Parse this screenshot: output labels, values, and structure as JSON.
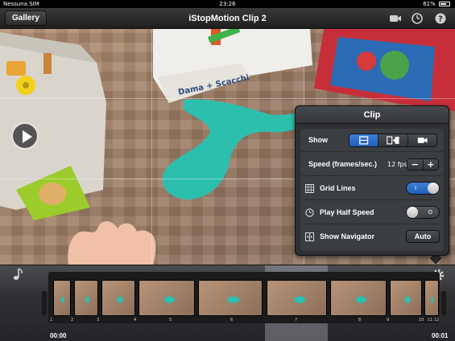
{
  "status_bar": {
    "carrier": "Nessuna SIM",
    "time": "23:26",
    "battery": "61%"
  },
  "nav": {
    "gallery_label": "Gallery",
    "title": "iStopMotion Clip 2",
    "icons": [
      "camera-icon",
      "timer-icon",
      "help-icon"
    ]
  },
  "clip_panel": {
    "title": "Clip",
    "show": {
      "label": "Show",
      "segments": [
        "film-icon",
        "frame-compare-icon",
        "camera-icon"
      ],
      "active_index": 0
    },
    "speed": {
      "label": "Speed (frames/sec.)",
      "value": "12 fps",
      "minus": "−",
      "plus": "+"
    },
    "grid_lines": {
      "label": "Grid Lines",
      "state": "on",
      "mark": "I"
    },
    "play_half_speed": {
      "label": "Play Half Speed",
      "state": "off",
      "mark": "O"
    },
    "show_navigator": {
      "label": "Show Navigator",
      "button": "Auto"
    }
  },
  "timeline": {
    "frame_numbers": [
      "1",
      "2",
      "3",
      "4",
      "5",
      "6",
      "7",
      "8",
      "9",
      "10",
      "11",
      "12"
    ],
    "selected_frame": 7,
    "start_time": "00:00",
    "end_time": "00:01"
  },
  "colors": {
    "accent": "#2f6fcb",
    "clay": "#2dbfae"
  }
}
